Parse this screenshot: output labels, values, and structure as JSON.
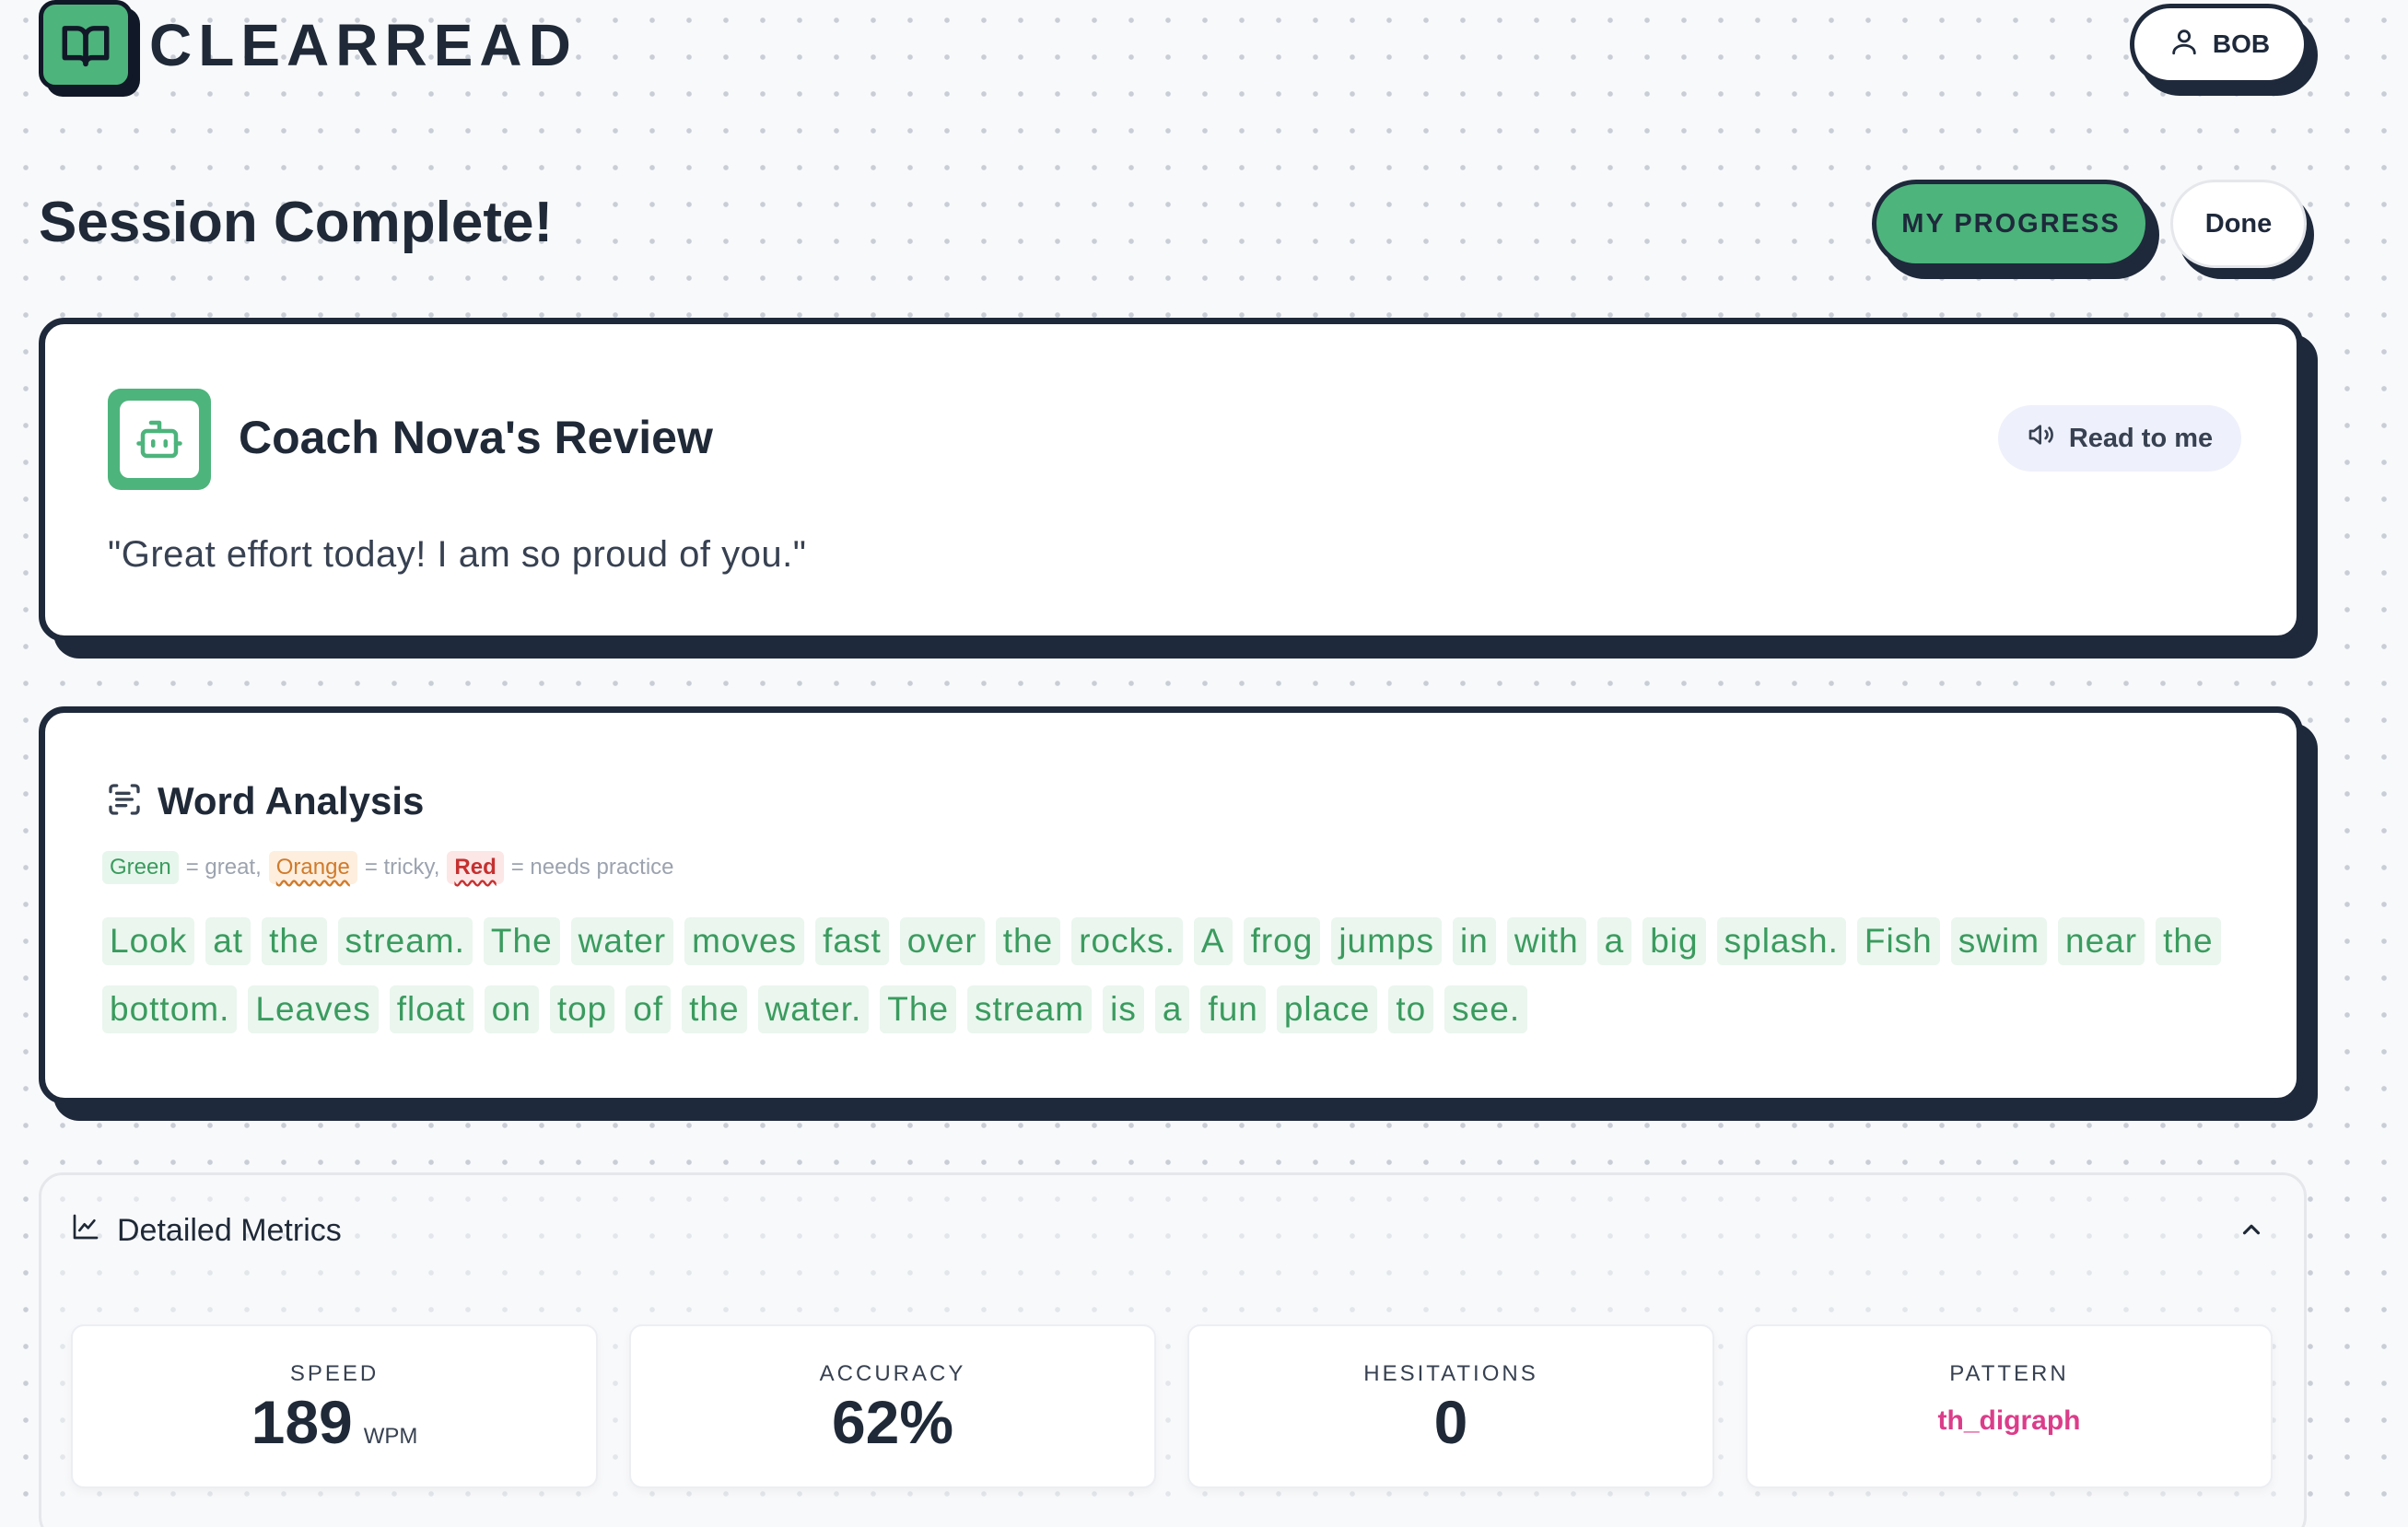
{
  "app": {
    "name": "CLEARREAD",
    "logo_icon": "book-open-icon"
  },
  "user": {
    "name": "BOB",
    "icon": "user-icon"
  },
  "page": {
    "title": "Session Complete!",
    "progress_button": "MY PROGRESS",
    "done_button": "Done"
  },
  "coach": {
    "title": "Coach Nova's Review",
    "avatar_icon": "bot-icon",
    "read_button": "Read to me",
    "read_icon": "speaker-icon",
    "quote": "\"Great effort today! I am so proud of you.\""
  },
  "word_analysis": {
    "title": "Word Analysis",
    "icon": "scan-text-icon",
    "legend": {
      "green": "Green",
      "green_desc": "= great,",
      "orange": "Orange",
      "orange_desc": "= tricky,",
      "red": "Red",
      "red_desc": "= needs practice"
    },
    "words": [
      "Look",
      "at",
      "the",
      "stream.",
      "The",
      "water",
      "moves",
      "fast",
      "over",
      "the",
      "rocks.",
      "A",
      "frog",
      "jumps",
      "in",
      "with",
      "a",
      "big",
      "splash.",
      "Fish",
      "swim",
      "near",
      "the",
      "bottom.",
      "Leaves",
      "float",
      "on",
      "top",
      "of",
      "the",
      "water.",
      "The",
      "stream",
      "is",
      "a",
      "fun",
      "place",
      "to",
      "see."
    ]
  },
  "metrics": {
    "title": "Detailed Metrics",
    "icon": "line-chart-icon",
    "speed": {
      "label": "SPEED",
      "value": "189",
      "unit": "WPM"
    },
    "accuracy": {
      "label": "ACCURACY",
      "value": "62%"
    },
    "hesitations": {
      "label": "HESITATIONS",
      "value": "0"
    },
    "pattern": {
      "label": "PATTERN",
      "value": "th_digraph"
    }
  },
  "colors": {
    "brand_green": "#4db47c",
    "ink": "#1e293b",
    "word_green": "#3a9b5e",
    "pattern_pink": "#db3d8a"
  }
}
